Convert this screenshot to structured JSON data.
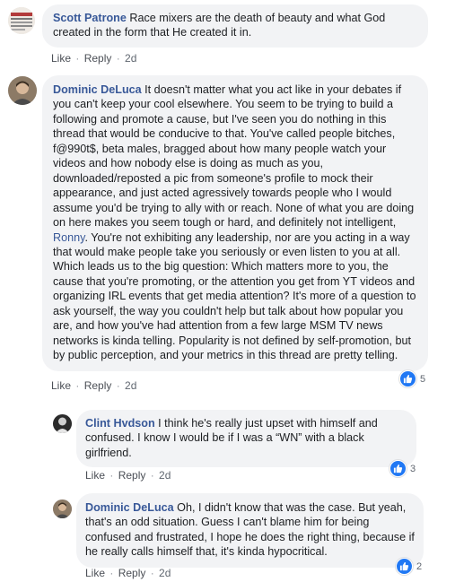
{
  "comments": [
    {
      "author": "Scott Patrone",
      "avatar_icon": "profile-photo",
      "text": "Race mixers are the death of beauty and what God created in the form that He created it in.",
      "actions": {
        "like": "Like",
        "reply": "Reply",
        "time": "2d"
      }
    },
    {
      "author": "Dominic DeLuca",
      "avatar_icon": "profile-photo",
      "text_before_mention": "It doesn't matter what you act like in your debates if you can't keep your cool elsewhere. You seem to be trying to build a following and promote a cause, but I've seen you do nothing in this thread that would be conducive to that. You've called people bitches, f@990t$, beta males, bragged about how many people watch your videos and how nobody else is doing as much as you, downloaded/reposted a pic from someone's profile to mock their appearance, and just acted agressively towards people who I would assume you'd be trying to ally with or reach. None of what you are doing on here makes you seem tough or hard, and definitely not intelligent,",
      "mention": "Ronny",
      "text_after_mention": ". You're not exhibiting any leadership, nor are you acting in a way that would make people take you seriously or even listen to you at all. Which leads us to the big question: Which matters more to you, the cause that you're promoting, or the attention you get from YT videos and organizing IRL events that get media attention? It's more of a question to ask yourself, the way you couldn't help but talk about how popular you are, and how you've had attention from a few large MSM TV news networks is kinda telling. Popularity is not defined by self-promotion, but by public perception, and your metrics in this thread are pretty telling.",
      "reaction_count": "5",
      "actions": {
        "like": "Like",
        "reply": "Reply",
        "time": "2d"
      },
      "replies": [
        {
          "author": "Clint Hvdson",
          "text": "I think he's really just upset with himself and confused. I know I would be if I was a “WN” with a black girlfriend.",
          "reaction_count": "3",
          "actions": {
            "like": "Like",
            "reply": "Reply",
            "time": "2d"
          }
        },
        {
          "author": "Dominic DeLuca",
          "text": "Oh, I didn't know that was the case. But yeah, that's an odd situation. Guess I can't blame him for being confused and frustrated, I hope he does the right thing, because if he really calls himself that, it's kinda hypocritical.",
          "reaction_count": "2",
          "actions": {
            "like": "Like",
            "reply": "Reply",
            "time": "2d"
          }
        }
      ]
    }
  ],
  "colors": {
    "author": "#385898",
    "bubble": "#f2f3f5",
    "like_badge": "#2078f4",
    "action_text": "#606770"
  }
}
